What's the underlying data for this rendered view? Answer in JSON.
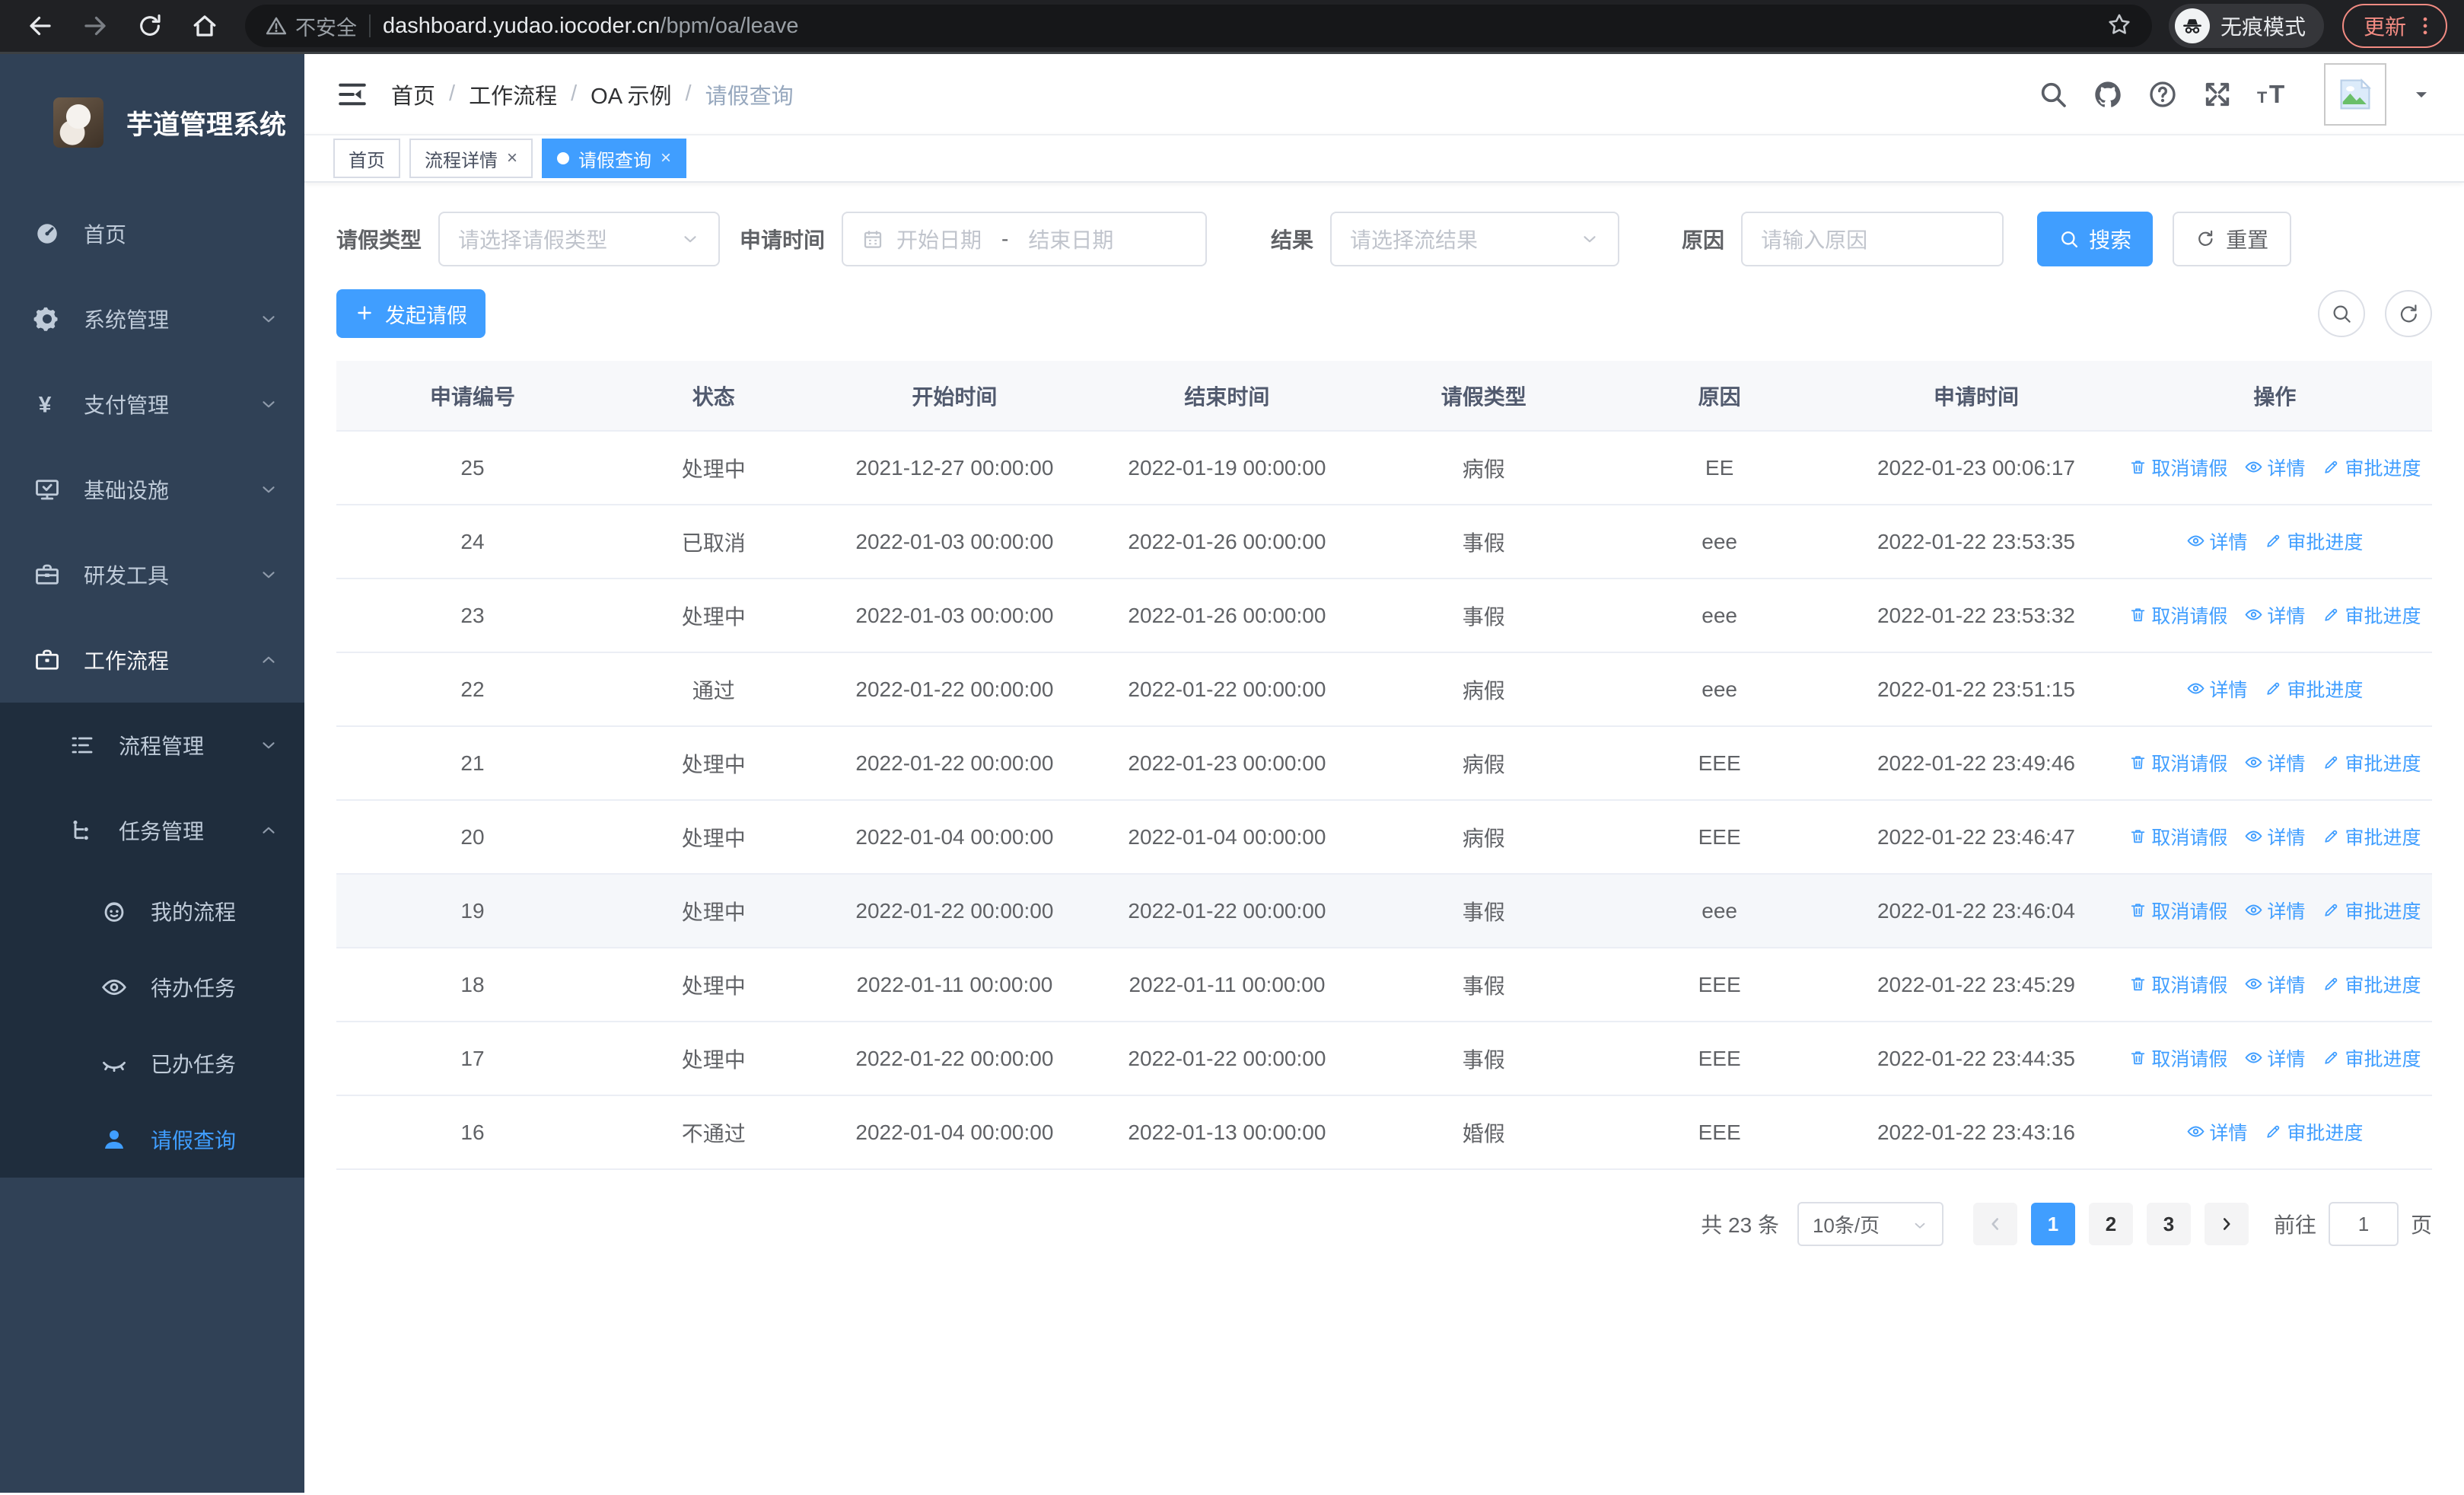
{
  "browser": {
    "security_label": "不安全",
    "url_host": "dashboard.yudao.iocoder.cn",
    "url_path": "/bpm/oa/leave",
    "incognito_label": "无痕模式",
    "update_label": "更新",
    "nav_icons": [
      "back-arrow-icon",
      "forward-arrow-icon",
      "reload-icon",
      "home-icon"
    ]
  },
  "sidebar": {
    "title": "芋道管理系统",
    "menu": [
      {
        "label": "首页",
        "icon": "dashboard-icon",
        "level": 1,
        "chevron": "",
        "sub": false,
        "active": false,
        "open": false
      },
      {
        "label": "系统管理",
        "icon": "gear-icon",
        "level": 1,
        "chevron": "down",
        "sub": false,
        "active": false,
        "open": false
      },
      {
        "label": "支付管理",
        "icon": "yen-icon",
        "level": 1,
        "chevron": "down",
        "sub": false,
        "active": false,
        "open": false
      },
      {
        "label": "基础设施",
        "icon": "monitor-icon",
        "level": 1,
        "chevron": "down",
        "sub": false,
        "active": false,
        "open": false
      },
      {
        "label": "研发工具",
        "icon": "toolbox-icon",
        "level": 1,
        "chevron": "down",
        "sub": false,
        "active": false,
        "open": false
      },
      {
        "label": "工作流程",
        "icon": "briefcase-icon",
        "level": 1,
        "chevron": "up",
        "sub": false,
        "active": false,
        "open": true
      },
      {
        "label": "流程管理",
        "icon": "flow-list-icon",
        "level": 2,
        "chevron": "down",
        "sub": true,
        "active": false,
        "open": false
      },
      {
        "label": "任务管理",
        "icon": "task-tree-icon",
        "level": 2,
        "chevron": "up",
        "sub": true,
        "active": false,
        "open": false
      },
      {
        "label": "我的流程",
        "icon": "robot-icon",
        "level": 3,
        "chevron": "",
        "sub": true,
        "active": false,
        "open": false
      },
      {
        "label": "待办任务",
        "icon": "eye-icon",
        "level": 3,
        "chevron": "",
        "sub": true,
        "active": false,
        "open": false
      },
      {
        "label": "已办任务",
        "icon": "eye-closed-icon",
        "level": 3,
        "chevron": "",
        "sub": true,
        "active": false,
        "open": false
      },
      {
        "label": "请假查询",
        "icon": "user-icon",
        "level": 3,
        "chevron": "",
        "sub": true,
        "active": true,
        "open": false
      }
    ]
  },
  "header": {
    "breadcrumb": [
      "首页",
      "工作流程",
      "OA 示例",
      "请假查询"
    ],
    "icons": [
      "search-icon",
      "github-icon",
      "help-icon",
      "fullscreen-icon",
      "font-size-icon"
    ]
  },
  "tabs": [
    {
      "label": "首页",
      "closable": false,
      "active": false
    },
    {
      "label": "流程详情",
      "closable": true,
      "active": false
    },
    {
      "label": "请假查询",
      "closable": true,
      "active": true
    }
  ],
  "filters": {
    "leave_type_label": "请假类型",
    "leave_type_placeholder": "请选择请假类型",
    "apply_time_label": "申请时间",
    "start_placeholder": "开始日期",
    "range_separator": "-",
    "end_placeholder": "结束日期",
    "result_label": "结果",
    "result_placeholder": "请选择流结果",
    "reason_label": "原因",
    "reason_placeholder": "请输入原因",
    "search_label": "搜索",
    "reset_label": "重置"
  },
  "toolbar": {
    "create_label": "发起请假"
  },
  "table": {
    "headers": [
      "申请编号",
      "状态",
      "开始时间",
      "结束时间",
      "请假类型",
      "原因",
      "申请时间",
      "操作"
    ],
    "action_labels": {
      "cancel": "取消请假",
      "detail": "详情",
      "progress": "审批进度"
    },
    "rows": [
      {
        "id": "25",
        "status": "处理中",
        "start": "2021-12-27 00:00:00",
        "end": "2022-01-19 00:00:00",
        "type": "病假",
        "reason": "EE",
        "apply_time": "2022-01-23 00:06:17",
        "actions": [
          "cancel",
          "detail",
          "progress"
        ],
        "highlight": false
      },
      {
        "id": "24",
        "status": "已取消",
        "start": "2022-01-03 00:00:00",
        "end": "2022-01-26 00:00:00",
        "type": "事假",
        "reason": "eee",
        "apply_time": "2022-01-22 23:53:35",
        "actions": [
          "detail",
          "progress"
        ],
        "highlight": false
      },
      {
        "id": "23",
        "status": "处理中",
        "start": "2022-01-03 00:00:00",
        "end": "2022-01-26 00:00:00",
        "type": "事假",
        "reason": "eee",
        "apply_time": "2022-01-22 23:53:32",
        "actions": [
          "cancel",
          "detail",
          "progress"
        ],
        "highlight": false
      },
      {
        "id": "22",
        "status": "通过",
        "start": "2022-01-22 00:00:00",
        "end": "2022-01-22 00:00:00",
        "type": "病假",
        "reason": "eee",
        "apply_time": "2022-01-22 23:51:15",
        "actions": [
          "detail",
          "progress"
        ],
        "highlight": false
      },
      {
        "id": "21",
        "status": "处理中",
        "start": "2022-01-22 00:00:00",
        "end": "2022-01-23 00:00:00",
        "type": "病假",
        "reason": "EEE",
        "apply_time": "2022-01-22 23:49:46",
        "actions": [
          "cancel",
          "detail",
          "progress"
        ],
        "highlight": false
      },
      {
        "id": "20",
        "status": "处理中",
        "start": "2022-01-04 00:00:00",
        "end": "2022-01-04 00:00:00",
        "type": "病假",
        "reason": "EEE",
        "apply_time": "2022-01-22 23:46:47",
        "actions": [
          "cancel",
          "detail",
          "progress"
        ],
        "highlight": false
      },
      {
        "id": "19",
        "status": "处理中",
        "start": "2022-01-22 00:00:00",
        "end": "2022-01-22 00:00:00",
        "type": "事假",
        "reason": "eee",
        "apply_time": "2022-01-22 23:46:04",
        "actions": [
          "cancel",
          "detail",
          "progress"
        ],
        "highlight": true
      },
      {
        "id": "18",
        "status": "处理中",
        "start": "2022-01-11 00:00:00",
        "end": "2022-01-11 00:00:00",
        "type": "事假",
        "reason": "EEE",
        "apply_time": "2022-01-22 23:45:29",
        "actions": [
          "cancel",
          "detail",
          "progress"
        ],
        "highlight": false
      },
      {
        "id": "17",
        "status": "处理中",
        "start": "2022-01-22 00:00:00",
        "end": "2022-01-22 00:00:00",
        "type": "事假",
        "reason": "EEE",
        "apply_time": "2022-01-22 23:44:35",
        "actions": [
          "cancel",
          "detail",
          "progress"
        ],
        "highlight": false
      },
      {
        "id": "16",
        "status": "不通过",
        "start": "2022-01-04 00:00:00",
        "end": "2022-01-13 00:00:00",
        "type": "婚假",
        "reason": "EEE",
        "apply_time": "2022-01-22 23:43:16",
        "actions": [
          "detail",
          "progress"
        ],
        "highlight": false
      }
    ]
  },
  "pagination": {
    "total": "共 23 条",
    "page_size": "10条/页",
    "pages": [
      "1",
      "2",
      "3"
    ],
    "active_page": "1",
    "goto_label": "前往",
    "goto_value": "1",
    "goto_suffix": "页"
  },
  "colors": {
    "primary": "#409eff",
    "sidebar_bg": "#304156",
    "submenu_bg": "#1f2d3d",
    "update_chip": "#f28b82"
  }
}
